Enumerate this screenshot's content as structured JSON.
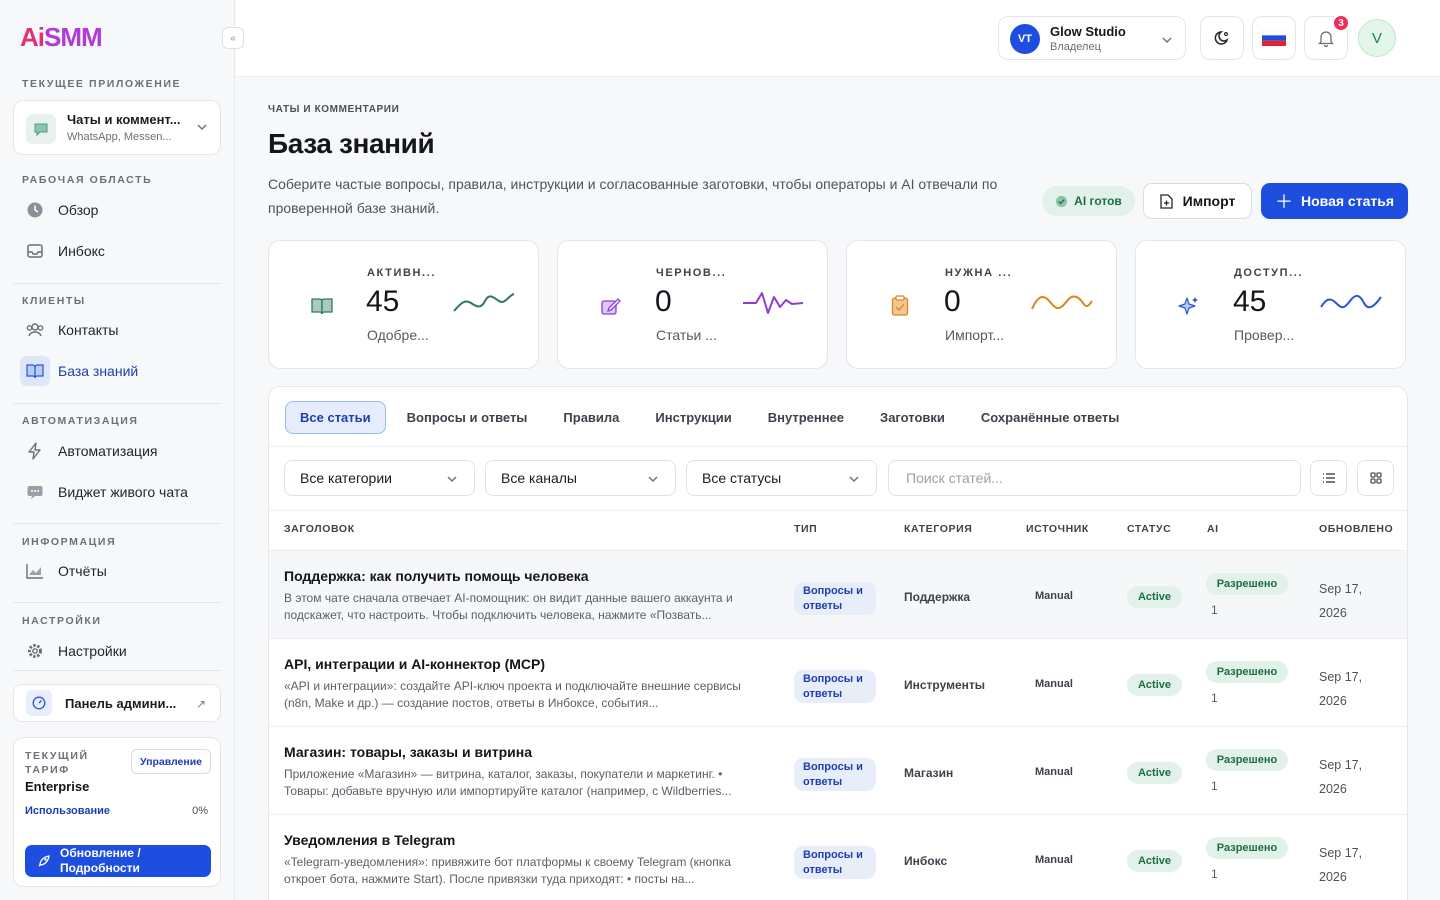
{
  "brand": {
    "ai": "Ai",
    "smm": "SMM"
  },
  "sidebar": {
    "collapse_glyph": "«",
    "current_app_title": "ТЕКУЩЕЕ ПРИЛОЖЕНИЕ",
    "current_app": {
      "name": "Чаты и коммент...",
      "sub": "WhatsApp, Messen..."
    },
    "sections": {
      "workspace": "РАБОЧАЯ ОБЛАСТЬ",
      "clients": "КЛИЕНТЫ",
      "automation": "АВТОМАТИЗАЦИЯ",
      "info": "ИНФОРМАЦИЯ",
      "settings": "НАСТРОЙКИ"
    },
    "items": {
      "overview": "Обзор",
      "inbox": "Инбокс",
      "contacts": "Контакты",
      "knowledge": "База знаний",
      "automation": "Автоматизация",
      "widget": "Виджет живого чата",
      "reports": "Отчёты",
      "settings": "Настройки"
    },
    "admin_panel": "Панель админи...",
    "plan": {
      "title": "ТЕКУЩИЙ ТАРИФ",
      "name": "Enterprise",
      "manage": "Управление",
      "usage_label": "Использование",
      "usage_value": "0%",
      "upgrade": "Обновление / Подробности"
    }
  },
  "header": {
    "org_initials": "VT",
    "org_name": "Glow Studio",
    "org_role": "Владелец",
    "notifications_count": "3",
    "user_initial": "V"
  },
  "page": {
    "breadcrumb": "ЧАТЫ И КОММЕНТАРИИ",
    "title": "База знаний",
    "description": "Соберите частые вопросы, правила, инструкции и согласованные заготовки, чтобы операторы и AI отвечали по проверенной базе знаний.",
    "ai_ready": "AI готов",
    "import": "Импорт",
    "new_article": "Новая статья"
  },
  "stats": [
    {
      "label": "АКТИВН...",
      "value": "45",
      "sub": "Одобре...",
      "color": "#2f7a5f",
      "bg": "#e6f0ec"
    },
    {
      "label": "ЧЕРНОВ...",
      "value": "0",
      "sub": "Статьи ...",
      "color": "#8a3fd6",
      "bg": "#efe7fb"
    },
    {
      "label": "НУЖНА ...",
      "value": "0",
      "sub": "Импорт...",
      "color": "#d9861c",
      "bg": "#fcefe1"
    },
    {
      "label": "ДОСТУП...",
      "value": "45",
      "sub": "Провер...",
      "color": "#2b55d6",
      "bg": "#e6ecfb"
    }
  ],
  "tabs": [
    "Все статьи",
    "Вопросы и ответы",
    "Правила",
    "Инструкции",
    "Внутреннее",
    "Заготовки",
    "Сохранённые ответы"
  ],
  "filters": {
    "category": "Все категории",
    "channel": "Все каналы",
    "status": "Все статусы",
    "search_placeholder": "Поиск статей..."
  },
  "table": {
    "headers": {
      "title": "ЗАГОЛОВОК",
      "type": "ТИП",
      "category": "КАТЕГОРИЯ",
      "source": "ИСТОЧНИК",
      "status": "СТАТУС",
      "ai": "AI",
      "updated": "ОБНОВЛЕНО"
    },
    "rows": [
      {
        "title": "Поддержка: как получить помощь человека",
        "desc": "В этом чате сначала отвечает AI-помощник: он видит данные вашего аккаунта и подскажет, что настроить. Чтобы подключить человека, нажмите «Позвать...",
        "type": "Вопросы и ответы",
        "category": "Поддержка",
        "source": "Manual",
        "status": "Active",
        "ai": "Разрешено",
        "ai_count": "1",
        "updated": "Sep 17, 2026"
      },
      {
        "title": "API, интеграции и AI-коннектор (MCP)",
        "desc": "«API и интеграции»: создайте API-ключ проекта и подключайте внешние сервисы (n8n, Make и др.) — создание постов, ответы в Инбоксе, события...",
        "type": "Вопросы и ответы",
        "category": "Инструменты",
        "source": "Manual",
        "status": "Active",
        "ai": "Разрешено",
        "ai_count": "1",
        "updated": "Sep 17, 2026"
      },
      {
        "title": "Магазин: товары, заказы и витрина",
        "desc": "Приложение «Магазин» — витрина, каталог, заказы, покупатели и маркетинг. • Товары: добавьте вручную или импортируйте каталог (например, с Wildberries...",
        "type": "Вопросы и ответы",
        "category": "Магазин",
        "source": "Manual",
        "status": "Active",
        "ai": "Разрешено",
        "ai_count": "1",
        "updated": "Sep 17, 2026"
      },
      {
        "title": "Уведомления в Telegram",
        "desc": "«Telegram-уведомления»: привяжите бот платформы к своему Telegram (кнопка откроет бота, нажмите Start). После привязки туда приходят: • посты на...",
        "type": "Вопросы и ответы",
        "category": "Инбокс",
        "source": "Manual",
        "status": "Active",
        "ai": "Разрешено",
        "ai_count": "1",
        "updated": "Sep 17, 2026"
      }
    ]
  }
}
